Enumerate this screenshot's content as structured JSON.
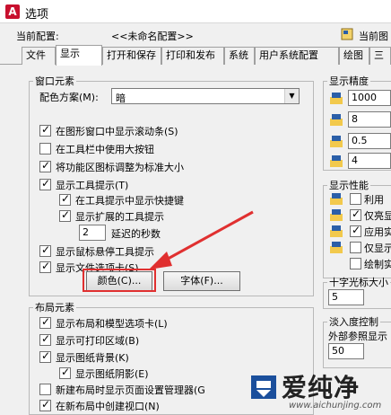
{
  "window": {
    "title": "选项"
  },
  "profile": {
    "label": "当前配置:",
    "value": "<<未命名配置>>",
    "drawing_label": "当前图"
  },
  "tabs": [
    {
      "label": "文件"
    },
    {
      "label": "显示"
    },
    {
      "label": "打开和保存"
    },
    {
      "label": "打印和发布"
    },
    {
      "label": "系统"
    },
    {
      "label": "用户系统配置"
    },
    {
      "label": "绘图"
    },
    {
      "label": "三"
    }
  ],
  "window_elements": {
    "title": "窗口元素",
    "color_scheme_label": "配色方案(M):",
    "color_scheme_value": "暗",
    "options": [
      {
        "label": "在图形窗口中显示滚动条(S)",
        "checked": true
      },
      {
        "label": "在工具栏中使用大按钮",
        "checked": false
      },
      {
        "label": "将功能区图标调整为标准大小",
        "checked": true
      },
      {
        "label": "显示工具提示(T)",
        "checked": true
      },
      {
        "label": "在工具提示中显示快捷键",
        "checked": true
      },
      {
        "label": "显示扩展的工具提示",
        "checked": true
      },
      {
        "label": "显示鼠标悬停工具提示",
        "checked": true
      },
      {
        "label": "显示文件选项卡(S)",
        "checked": true
      }
    ],
    "delay_value": "2",
    "delay_label": "延迟的秒数",
    "colors_button": "颜色(C)...",
    "fonts_button": "字体(F)..."
  },
  "layout_elements": {
    "title": "布局元素",
    "options": [
      {
        "label": "显示布局和模型选项卡(L)",
        "checked": true
      },
      {
        "label": "显示可打印区域(B)",
        "checked": true
      },
      {
        "label": "显示图纸背景(K)",
        "checked": true
      },
      {
        "label": "显示图纸阴影(E)",
        "checked": true
      },
      {
        "label": "新建布局时显示页面设置管理器(G",
        "checked": false
      },
      {
        "label": "在新布局中创建视口(N)",
        "checked": true
      }
    ]
  },
  "display_resolution": {
    "title": "显示精度",
    "values": [
      "1000",
      "8",
      "0.5",
      "4"
    ]
  },
  "display_performance": {
    "title": "显示性能",
    "options": [
      {
        "label": "利用",
        "checked": false
      },
      {
        "label": "仅亮显",
        "checked": true
      },
      {
        "label": "应用实",
        "checked": true
      },
      {
        "label": "仅显示",
        "checked": false
      },
      {
        "label": "绘制实",
        "checked": false
      }
    ]
  },
  "crosshair": {
    "title": "十字光标大小",
    "value": "5"
  },
  "fade_control": {
    "title": "淡入度控制",
    "xref_label": "外部参照显示",
    "value": "50"
  },
  "watermark": {
    "text": "爱纯净",
    "url": "www.aichunjing.com"
  },
  "colors": {
    "highlight": "#e03030",
    "arrow": "#e03030"
  }
}
